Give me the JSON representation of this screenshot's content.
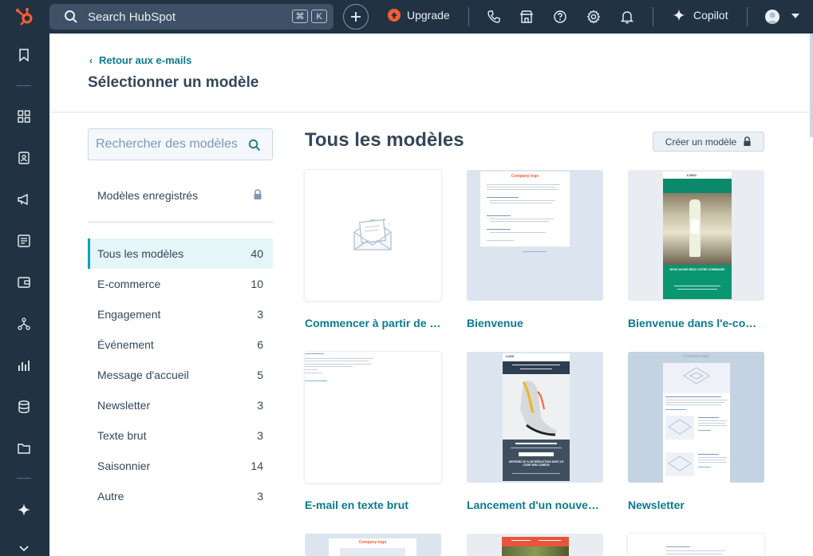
{
  "topbar": {
    "search_placeholder": "Search HubSpot",
    "kbd_cmd": "⌘",
    "kbd_k": "K",
    "upgrade_label": "Upgrade",
    "copilot_label": "Copilot",
    "brand_color": "#ff5c35",
    "bar_color": "#213343"
  },
  "header": {
    "back_label": "Retour aux e-mails",
    "title": "Sélectionner un modèle"
  },
  "left": {
    "search_placeholder": "Rechercher des modèles",
    "saved_label": "Modèles enregistrés",
    "categories": [
      {
        "label": "Tous les modèles",
        "count": "40"
      },
      {
        "label": "E-commerce",
        "count": "10"
      },
      {
        "label": "Engagement",
        "count": "3"
      },
      {
        "label": "Événement",
        "count": "6"
      },
      {
        "label": "Message d'accueil",
        "count": "5"
      },
      {
        "label": "Newsletter",
        "count": "3"
      },
      {
        "label": "Texte brut",
        "count": "3"
      },
      {
        "label": "Saisonnier",
        "count": "14"
      },
      {
        "label": "Autre",
        "count": "3"
      }
    ]
  },
  "content": {
    "section_title": "Tous les modèles",
    "create_button": "Créer un modèle",
    "templates": [
      {
        "label": "Commencer à partir de zéro"
      },
      {
        "label": "Bienvenue"
      },
      {
        "label": "Bienvenue dans l'e-commerce"
      },
      {
        "label": "E-mail en texte brut"
      },
      {
        "label": "Lancement d'un nouveau produit"
      },
      {
        "label": "Newsletter"
      }
    ],
    "thumb_texts": {
      "company_logo": "Company logo",
      "logo": "LOGO",
      "wine_banner": "NOUS AVONS REÇU VOTRE COMMANDE",
      "shoe_banner": "OBTENEZ 20 % DE RÉDUCTION AVEC LE CODE WELCOME20"
    }
  }
}
